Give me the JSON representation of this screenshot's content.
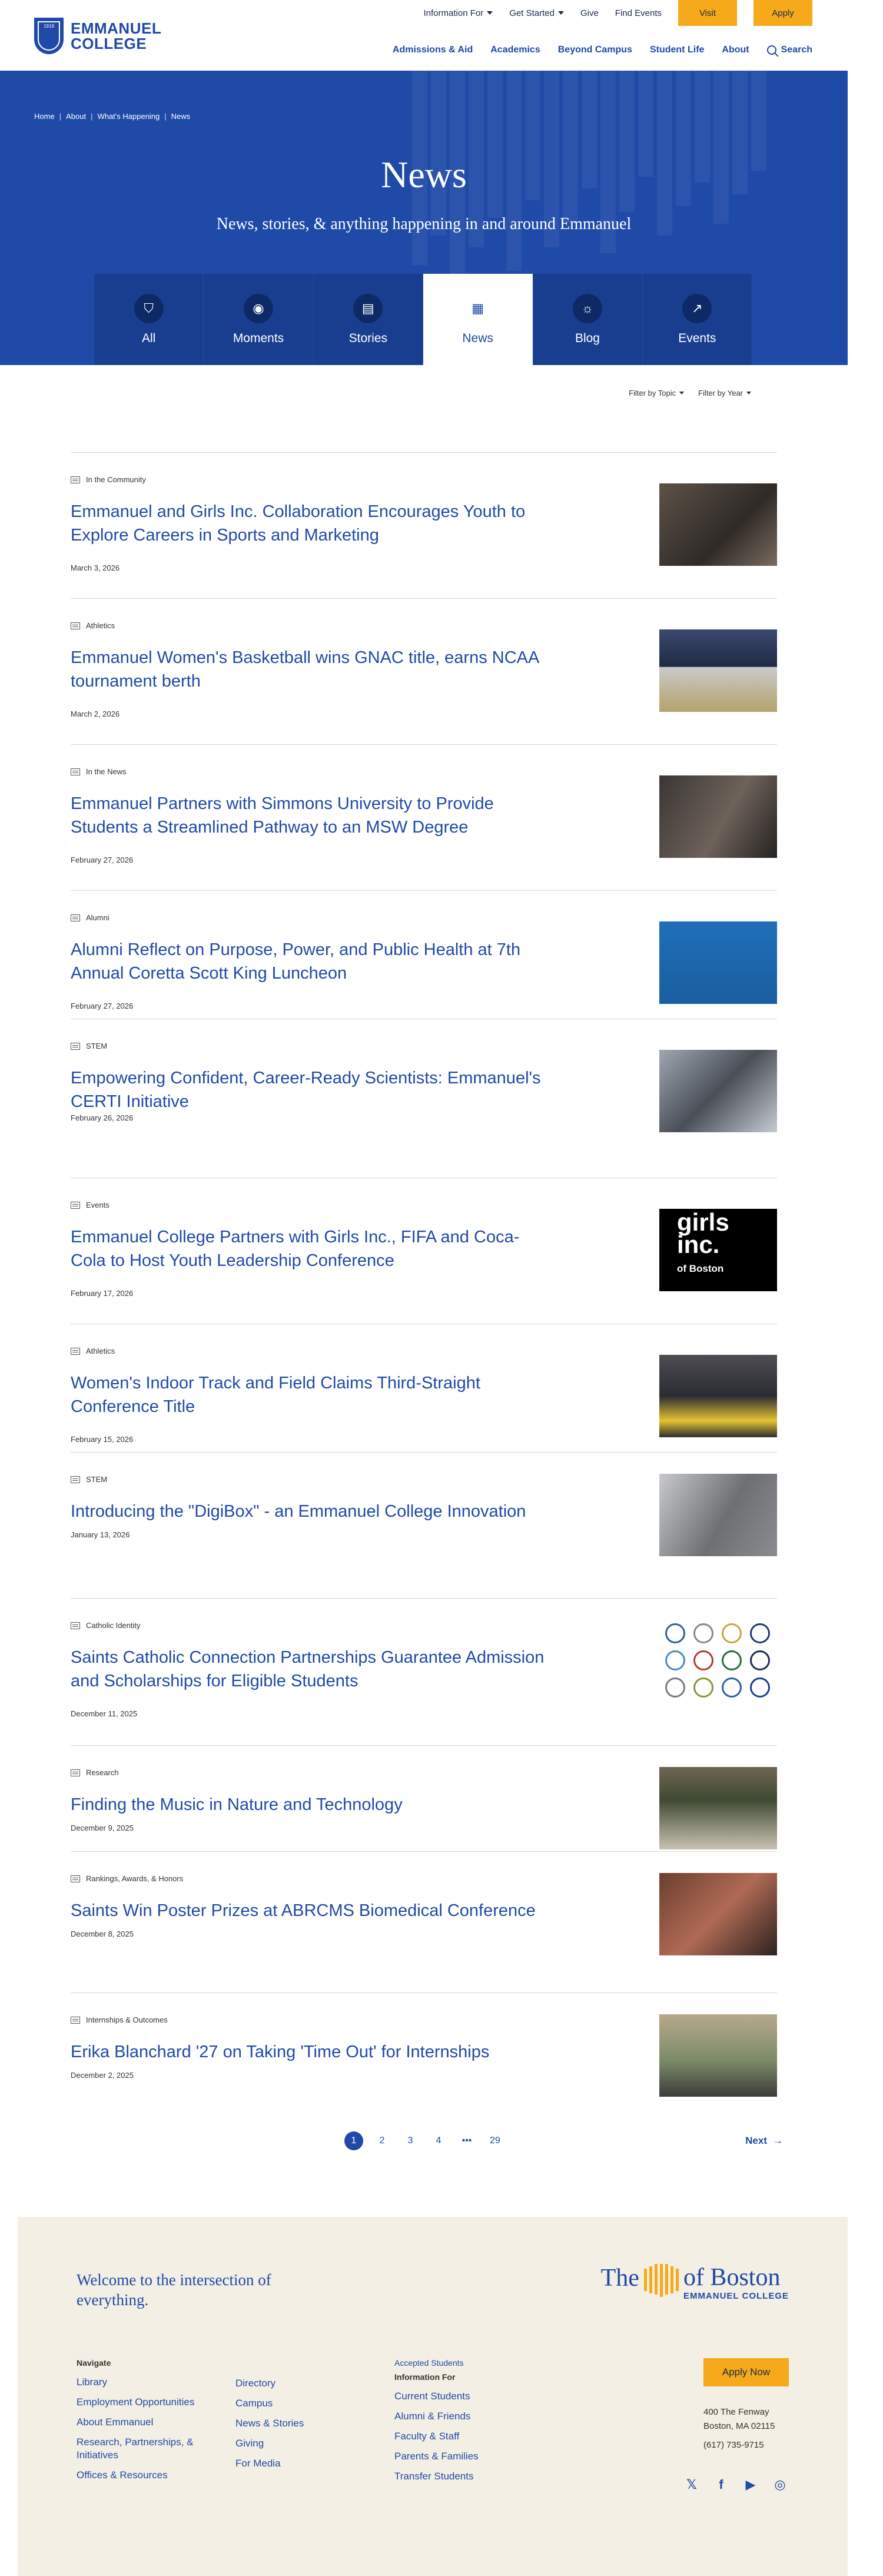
{
  "header": {
    "logo_year": "1919",
    "logo_line1": "EMMANUEL",
    "logo_line2": "COLLEGE",
    "top_nav": [
      {
        "label": "Information For",
        "dropdown": true
      },
      {
        "label": "Get Started",
        "dropdown": true
      },
      {
        "label": "Give",
        "dropdown": false
      },
      {
        "label": "Find Events",
        "dropdown": false
      }
    ],
    "visit_label": "Visit",
    "apply_label": "Apply",
    "main_nav": [
      "Admissions & Aid",
      "Academics",
      "Beyond Campus",
      "Student Life",
      "About"
    ],
    "search_label": "Search"
  },
  "hero": {
    "breadcrumbs": [
      "Home",
      "About",
      "What's Happening",
      "News"
    ],
    "title": "News",
    "subtitle": "News, stories, & anything happening in and around Emmanuel",
    "tabs": [
      {
        "label": "All",
        "icon": "shield-icon",
        "glyph": "⛉"
      },
      {
        "label": "Moments",
        "icon": "person-circle-icon",
        "glyph": "◉"
      },
      {
        "label": "Stories",
        "icon": "book-icon",
        "glyph": "▤"
      },
      {
        "label": "News",
        "icon": "newspaper-icon",
        "glyph": "▦",
        "active": true
      },
      {
        "label": "Blog",
        "icon": "lightbulb-icon",
        "glyph": "☼"
      },
      {
        "label": "Events",
        "icon": "external-link-icon",
        "glyph": "↗"
      }
    ]
  },
  "filters": {
    "topic": "Filter by Topic",
    "year": "Filter by Year"
  },
  "articles": [
    {
      "category": "In the Community",
      "title": "Emmanuel and Girls Inc. Collaboration Encourages Youth to Explore Careers in Sports and Marketing",
      "date": "March 3, 2026"
    },
    {
      "category": "Athletics",
      "title": "Emmanuel Women's Basketball wins GNAC title, earns NCAA tournament berth",
      "date": "March 2, 2026"
    },
    {
      "category": "In the News",
      "title": "Emmanuel Partners with Simmons University to Provide Students a Streamlined Pathway to an MSW Degree",
      "date": "February 27, 2026"
    },
    {
      "category": "Alumni",
      "title": "Alumni Reflect on Purpose, Power, and Public Health at 7th Annual Coretta Scott King Luncheon",
      "date": "February 27, 2026"
    },
    {
      "category": "STEM",
      "title": "Empowering Confident, Career-Ready Scientists: Emmanuel's CERTI Initiative",
      "date": "February 26, 2026"
    },
    {
      "category": "Events",
      "title": "Emmanuel College Partners with Girls Inc., FIFA and Coca-Cola to Host Youth Leadership Conference",
      "date": "February 17, 2026",
      "thumb_text": [
        "girls",
        "inc.",
        "of Boston"
      ]
    },
    {
      "category": "Athletics",
      "title": "Women's Indoor Track and Field Claims Third-Straight Conference Title",
      "date": "February 15, 2026"
    },
    {
      "category": "STEM",
      "title": "Introducing the \"DigiBox\" - an Emmanuel College Innovation",
      "date": "January 13, 2026"
    },
    {
      "category": "Catholic Identity",
      "title": "Saints Catholic Connection Partnerships Guarantee Admission and Scholarships for Eligible Students",
      "date": "December 11, 2025"
    },
    {
      "category": "Research",
      "title": "Finding the Music in Nature and Technology",
      "date": "December 9, 2025"
    },
    {
      "category": "Rankings, Awards, & Honors",
      "title": "Saints Win Poster Prizes at ABRCMS Biomedical Conference",
      "date": "December 8, 2025"
    },
    {
      "category": "Internships & Outcomes",
      "title": "Erika Blanchard '27 on Taking 'Time Out' for Internships",
      "date": "December 2, 2025"
    }
  ],
  "pagination": {
    "pages": [
      "1",
      "2",
      "3",
      "4",
      "•••",
      "29"
    ],
    "current": "1",
    "next_label": "Next"
  },
  "footer": {
    "welcome": "Welcome to the intersection of everything.",
    "brand_the": "The",
    "brand_of_boston": "of Boston",
    "brand_college": "EMMANUEL COLLEGE",
    "navigate_heading": "Navigate",
    "navigate_col1": [
      "Library",
      "Employment Opportunities",
      "About Emmanuel",
      "Research, Partnerships, & Initiatives",
      "Offices & Resources"
    ],
    "navigate_col2": [
      "Directory",
      "Campus",
      "News & Stories",
      "Giving",
      "For Media"
    ],
    "accepted_students": "Accepted Students",
    "info_heading": "Information For",
    "info_links": [
      "Current Students",
      "Alumni & Friends",
      "Faculty & Staff",
      "Parents & Families",
      "Transfer Students"
    ],
    "apply_now": "Apply Now",
    "address_line1": "400 The Fenway",
    "address_line2": "Boston, MA 02115",
    "phone": "(617) 735-9715",
    "social": [
      {
        "icon": "x-twitter-icon",
        "glyph": "𝕏"
      },
      {
        "icon": "facebook-icon",
        "glyph": "f"
      },
      {
        "icon": "youtube-icon",
        "glyph": "▶"
      },
      {
        "icon": "instagram-icon",
        "glyph": "◎"
      }
    ]
  },
  "colors": {
    "brand_blue": "#1f4aa8",
    "accent_yellow": "#f5a91b",
    "footer_bg": "#f4efe4"
  }
}
